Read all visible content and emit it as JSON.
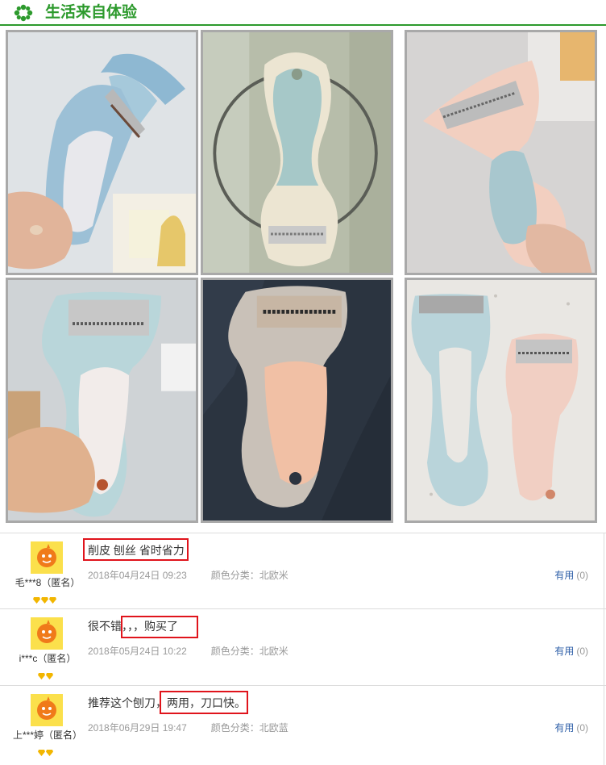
{
  "header": {
    "title": "生活来自体验",
    "icon": "green-flower-icon",
    "accent": "#2d9a2d"
  },
  "photos": [
    {
      "alt": "blue peeler held in hand"
    },
    {
      "alt": "cream peeler hanging on rack"
    },
    {
      "alt": "pink peeler held in hand"
    },
    {
      "alt": "light blue peeler held in hand"
    },
    {
      "alt": "peach peeler on dark cloth"
    },
    {
      "alt": "blue and pink peelers on counter"
    }
  ],
  "reviews": [
    {
      "username": "毛***8（匿名）",
      "comment": "削皮 刨丝 省时省力",
      "date": "2018年04月24日 09:23",
      "color_label": "颜色分类：北欧米",
      "useful_label": "有用",
      "useful_count": "(0)"
    },
    {
      "username": "i***c（匿名）",
      "comment": "很不错，，，购买了",
      "date": "2018年05月24日 10:22",
      "color_label": "颜色分类：北欧米",
      "useful_label": "有用",
      "useful_count": "(0)"
    },
    {
      "username": "上***婷（匿名）",
      "comment": "推荐这个刨刀，两用，刀口快。",
      "date": "2018年06月29日 19:47",
      "color_label": "颜色分类：北欧蓝",
      "useful_label": "有用",
      "useful_count": "(0)"
    }
  ],
  "colors": {
    "highlight": "#e0141c",
    "link": "#2e5fa8",
    "meta": "#999999"
  }
}
